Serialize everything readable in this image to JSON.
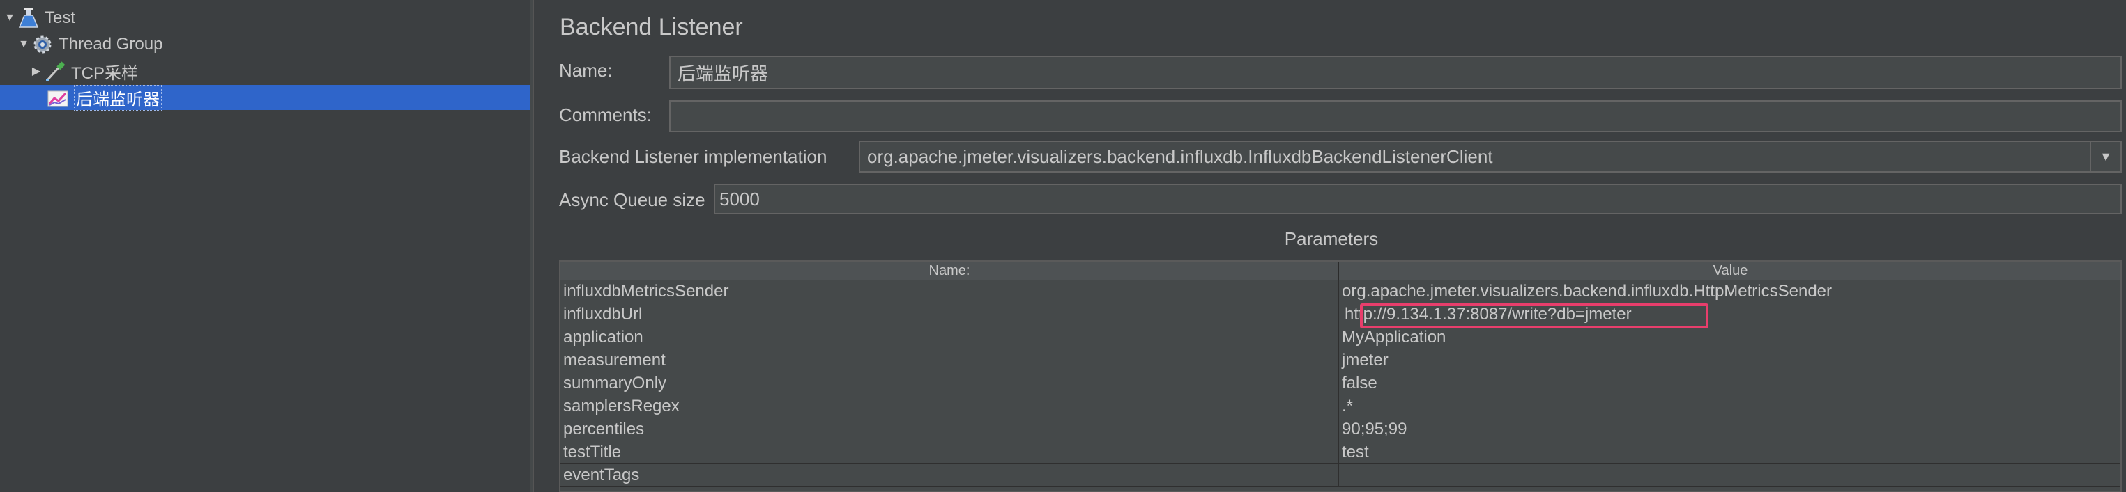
{
  "tree": {
    "items": [
      {
        "label": "Test",
        "icon": "flask-icon",
        "expanded": true,
        "level": 0,
        "selected": false
      },
      {
        "label": "Thread Group",
        "icon": "gear-icon",
        "expanded": true,
        "level": 1,
        "selected": false
      },
      {
        "label": "TCP采样",
        "icon": "pipette-icon",
        "expanded": false,
        "level": 2,
        "selected": false
      },
      {
        "label": "后端监听器",
        "icon": "chart-icon",
        "expanded": false,
        "level": 2,
        "selected": true
      }
    ]
  },
  "panel": {
    "title": "Backend Listener",
    "name_label": "Name:",
    "name_value": "后端监听器",
    "comments_label": "Comments:",
    "comments_value": "",
    "impl_label": "Backend Listener implementation",
    "impl_value": "org.apache.jmeter.visualizers.backend.influxdb.InfluxdbBackendListenerClient",
    "queue_label": "Async Queue size",
    "queue_value": "5000",
    "params_title": "Parameters"
  },
  "table": {
    "headers": [
      "Name:",
      "Value"
    ],
    "rows": [
      {
        "name": "influxdbMetricsSender",
        "value": "org.apache.jmeter.visualizers.backend.influxdb.HttpMetricsSender"
      },
      {
        "name": "influxdbUrl",
        "value": "http://9.134.1.37:8087/write?db=jmeter"
      },
      {
        "name": "application",
        "value": "MyApplication"
      },
      {
        "name": "measurement",
        "value": "jmeter"
      },
      {
        "name": "summaryOnly",
        "value": "false"
      },
      {
        "name": "samplersRegex",
        "value": ".*"
      },
      {
        "name": "percentiles",
        "value": "90;95;99"
      },
      {
        "name": "testTitle",
        "value": "test"
      },
      {
        "name": "eventTags",
        "value": ""
      }
    ],
    "highlighted_row": 1
  },
  "colors": {
    "background": "#3c3f41",
    "selection": "#2f65ca",
    "highlight": "#e83e6c"
  }
}
